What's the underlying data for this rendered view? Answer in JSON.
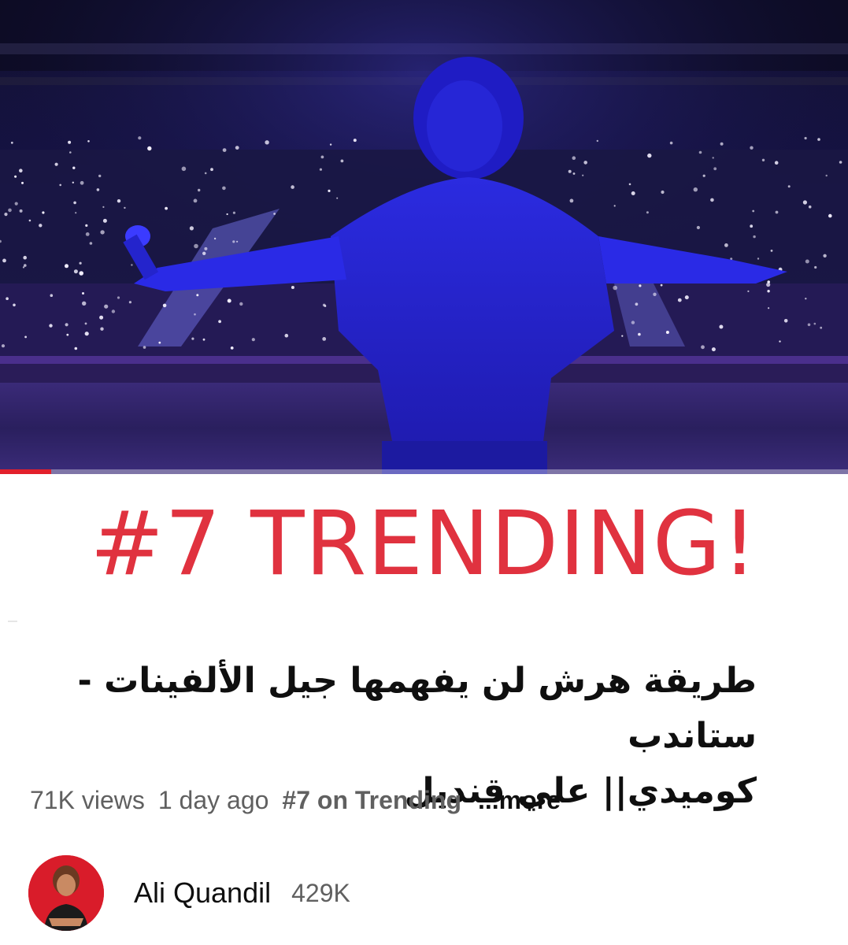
{
  "video": {
    "thumbnail_icon": "concert-stage-performer-image",
    "progress_fraction": 0.06,
    "colors": {
      "progress": "#e2202b"
    }
  },
  "banner": {
    "text": "#7 TRENDING!",
    "color": "#e0323f"
  },
  "title": {
    "line1": "طريقة هرش لن يفهمها جيل الألفينات - ستاندب",
    "line2": "كوميدي|| علي قنديل"
  },
  "meta": {
    "views": "71K views",
    "age": "1 day ago",
    "trending": "#7 on Trending",
    "more": "...more"
  },
  "channel": {
    "name": "Ali Quandil",
    "subscribers": "429K",
    "avatar_icon": "avatar-photo",
    "avatar_bg": "#d91c2a"
  }
}
